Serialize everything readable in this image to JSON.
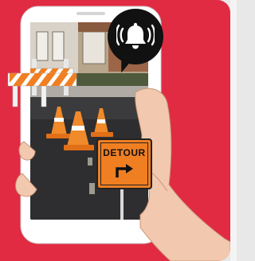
{
  "illustration": {
    "background_color": "#e12b42",
    "phone_color": "#ffffff",
    "notification_icon": "bell-ringing-icon",
    "sign": {
      "text": "DETOUR",
      "arrow_icon": "turn-right-arrow-icon",
      "color": "#f07f22"
    },
    "cone_color": "#f08a2a",
    "barricade_colors": [
      "#f07f22",
      "#ffffff"
    ]
  }
}
